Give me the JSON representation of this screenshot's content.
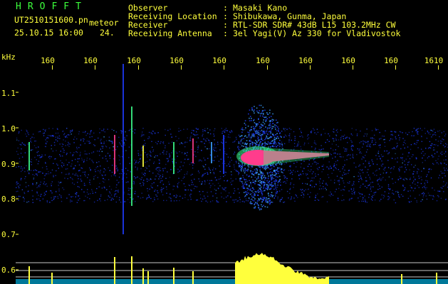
{
  "header": {
    "brand": "HROFFT",
    "filename": "UT2510151600.pn",
    "mode": "meteor",
    "datetime": "25.10.15 16:00",
    "count": "24."
  },
  "station": {
    "observer_label": "Observer",
    "observer_value": "Masaki Kano",
    "location_label": "Receiving Location",
    "location_value": "Shibukawa, Gunma, Japan",
    "receiver_label": "Receiver",
    "receiver_value": "RTL-SDR SDR# 43dB L15 103.2MHz CW",
    "antenna_label": "Receiving Antenna",
    "antenna_value": "3el Yagi(V) Az 330 for Vladivostok",
    "separator": ":"
  },
  "axes": {
    "y_unit": "kHz",
    "y_ticks": [
      "1.1",
      "1.0",
      "0.9",
      "0.8",
      "0.7",
      "0.6"
    ],
    "x_ticks": [
      "160",
      "160",
      "160",
      "160",
      "160",
      "160",
      "160",
      "160",
      "160",
      "1610"
    ]
  },
  "colors": {
    "text": "#ffff3c",
    "brand": "#3cff3c",
    "echo_core": "#ff3c8c",
    "noise": "#1e3cff",
    "power_trace": "#00c8ff",
    "power_peak": "#ffff3c"
  }
}
